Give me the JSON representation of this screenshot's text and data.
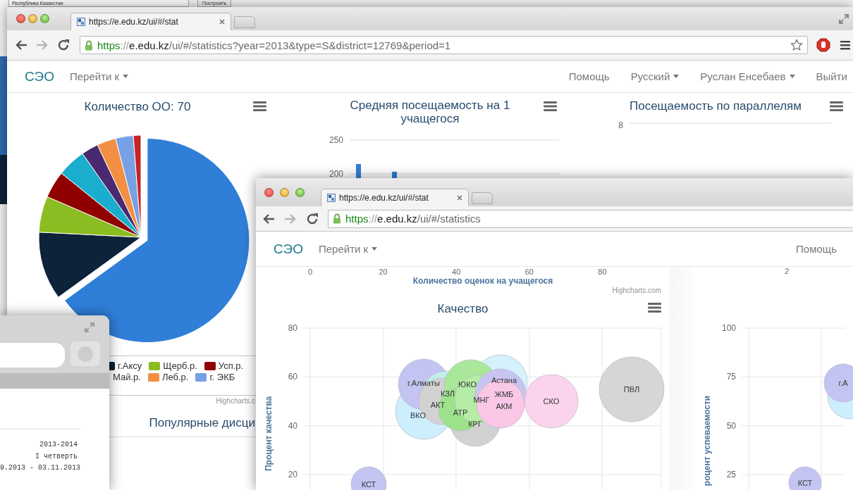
{
  "background_window": {
    "region_select": "Республика Казахстан",
    "build_button": "Построить"
  },
  "back_window": {
    "tab": {
      "title": "https://e.edu.kz/ui/#/stat"
    },
    "address": {
      "scheme": "https",
      "separator": "://",
      "host": "e.edu.kz",
      "path": "/ui/#/statistics?year=2013&type=S&district=12769&period=1"
    },
    "nav": {
      "brand": "СЭО",
      "left": [
        {
          "label": "Перейти к",
          "dropdown": true
        }
      ],
      "right": [
        {
          "label": "Помощь",
          "dropdown": false
        },
        {
          "label": "Русский",
          "dropdown": true
        },
        {
          "label": "Руслан Енсебаев",
          "dropdown": true
        },
        {
          "label": "Выйти",
          "dropdown": false
        }
      ]
    },
    "pie_panel": {
      "title": "Количество ОО: 70",
      "legend_rows": [
        [
          {
            "label": "г.Аксу",
            "color": "#0d233a"
          },
          {
            "label": "Щерб.р.",
            "color": "#8bbc21"
          },
          {
            "label": "Усп.р.",
            "color": "#910000"
          }
        ],
        [
          {
            "label": "Май.р."
          },
          {
            "label": "Леб.р.",
            "color": "#f28f43"
          },
          {
            "label": "г. ЭКБ",
            "color": "#77a1e5"
          }
        ]
      ],
      "credit": "Highcharts.c",
      "next_title": "Популярные дисци"
    },
    "attendance_panel": {
      "title": "Средняя посещаемость на 1 учащегося",
      "y_ticks": [
        "250",
        "200"
      ]
    },
    "grades_panel": {
      "title": "Посещаемость по параллелям",
      "y_tick": "8"
    }
  },
  "front_window": {
    "tab": {
      "title": "https://e.edu.kz/ui/#/stat"
    },
    "address": {
      "scheme": "https",
      "separator": "://",
      "host": "e.edu.kz",
      "path": "/ui/#/statistics"
    },
    "nav": {
      "brand": "СЭО",
      "left": [
        {
          "label": "Перейти к",
          "dropdown": true
        }
      ],
      "right": [
        {
          "label": "Помощь",
          "dropdown": false
        }
      ]
    },
    "scores_panel": {
      "x_ticks": [
        "0",
        "20",
        "40",
        "60",
        "80"
      ],
      "x_axis_title": "Количество оценок на учащегося",
      "credit": "Highcharts.com"
    },
    "quality_panel": {
      "title": "Качество",
      "y_ticks": [
        "80",
        "60",
        "40",
        "20"
      ],
      "y_axis_title": "Процент качества",
      "bubbles": [
        {
          "label": "ВКО",
          "color": "#cdeefc"
        },
        {
          "label": "г.Алматы",
          "color": "#c4c4f2"
        },
        {
          "label": "КЗЛ",
          "color": "#c2eeea"
        },
        {
          "label": "АКТ",
          "color": "#d2d2d2"
        },
        {
          "label": "Астана",
          "color": "#d4f1fc"
        },
        {
          "label": "ЮКО",
          "color": "#a9e89a"
        },
        {
          "label": "КРГ",
          "color": "#d2d2d2"
        },
        {
          "label": "АТР",
          "color": "#9be28a"
        },
        {
          "label": "МНГ",
          "color": "#b5eca6"
        },
        {
          "label": "ЖМБ",
          "color": "#c9c4ef"
        },
        {
          "label": "АКМ",
          "color": "#fac7e6"
        },
        {
          "label": "СКО",
          "color": "#fcd3ec"
        },
        {
          "label": "ПВЛ",
          "color": "#d6d6d6"
        },
        {
          "label": "КСТ",
          "color": "#c4c4f2"
        }
      ]
    },
    "success_panel": {
      "x_tick": "2",
      "y_ticks": [
        "100",
        "75",
        "50",
        "25"
      ],
      "y_axis_title": "роцент успеваемости",
      "bubbles": [
        {
          "color": "#cdeefc"
        },
        {
          "label": "г.А",
          "color": "#c4c4f2"
        },
        {
          "label": "КСТ",
          "color": "#c4c4f2"
        }
      ]
    }
  },
  "small_window": {
    "lines": [
      "2013-2014",
      "I четверть",
      "9.2013 - 03.11.2013"
    ]
  }
}
